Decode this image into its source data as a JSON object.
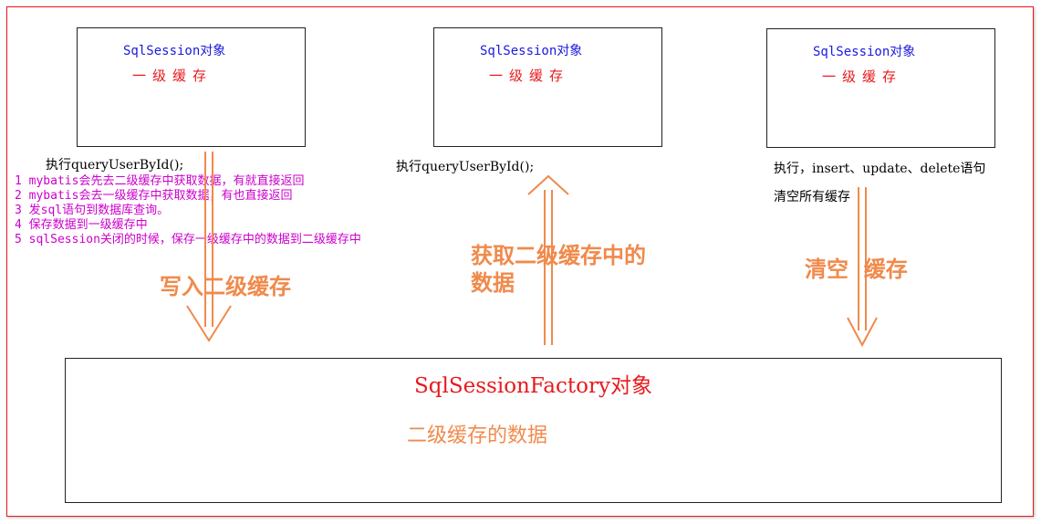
{
  "session_boxes": [
    {
      "title": "SqlSession对象",
      "cache": "一级缓存"
    },
    {
      "title": "SqlSession对象",
      "cache": "一级缓存"
    },
    {
      "title": "SqlSession对象",
      "cache": "一级缓存"
    }
  ],
  "left": {
    "exec": "执行queryUserById();",
    "steps": [
      "1 mybatis会先去二级缓存中获取数据，有就直接返回",
      "2 mybatis会去一级缓存中获取数据，有也直接返回",
      "3 发sql语句到数据库查询。",
      "4 保存数据到一级缓存中",
      "5 sqlSession关闭的时候，保存一级缓存中的数据到二级缓存中"
    ],
    "arrow_label": "写入二级缓存"
  },
  "middle": {
    "exec": "执行queryUserById();",
    "arrow_label_line1": "获取二级缓存中的",
    "arrow_label_line2": "数据"
  },
  "right": {
    "exec": "执行，insert、update、delete语句",
    "clear": "清空所有缓存",
    "arrow_label": "清空  缓存"
  },
  "factory": {
    "title": "SqlSessionFactory对象",
    "data": "二级缓存的数据"
  },
  "colors": {
    "frame": "#e8191c",
    "arrow": "#f08a4b",
    "steps_text": "#cc00cc",
    "box_title": "#1a1adf",
    "cache_text": "#e8191c"
  }
}
